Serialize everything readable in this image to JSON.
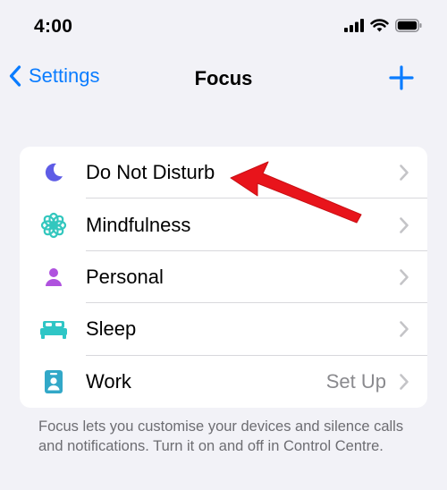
{
  "status_bar": {
    "time": "4:00"
  },
  "nav": {
    "back_label": "Settings",
    "title": "Focus"
  },
  "focus_list": {
    "items": [
      {
        "label": "Do Not Disturb",
        "icon": "moon-icon",
        "value": ""
      },
      {
        "label": "Mindfulness",
        "icon": "flower-icon",
        "value": ""
      },
      {
        "label": "Personal",
        "icon": "person-icon",
        "value": ""
      },
      {
        "label": "Sleep",
        "icon": "bed-icon",
        "value": ""
      },
      {
        "label": "Work",
        "icon": "id-badge-icon",
        "value": "Set Up"
      }
    ]
  },
  "footer_text": "Focus lets you customise your devices and silence calls and notifications. Turn it on and off in Control Centre.",
  "colors": {
    "accent": "#0a7cff",
    "moon": "#5e5ce6",
    "mindfulness": "#33c7be",
    "personal": "#af52de",
    "sleep": "#2fc6c6",
    "work": "#32a8c8",
    "annotation": "#e8141b"
  }
}
